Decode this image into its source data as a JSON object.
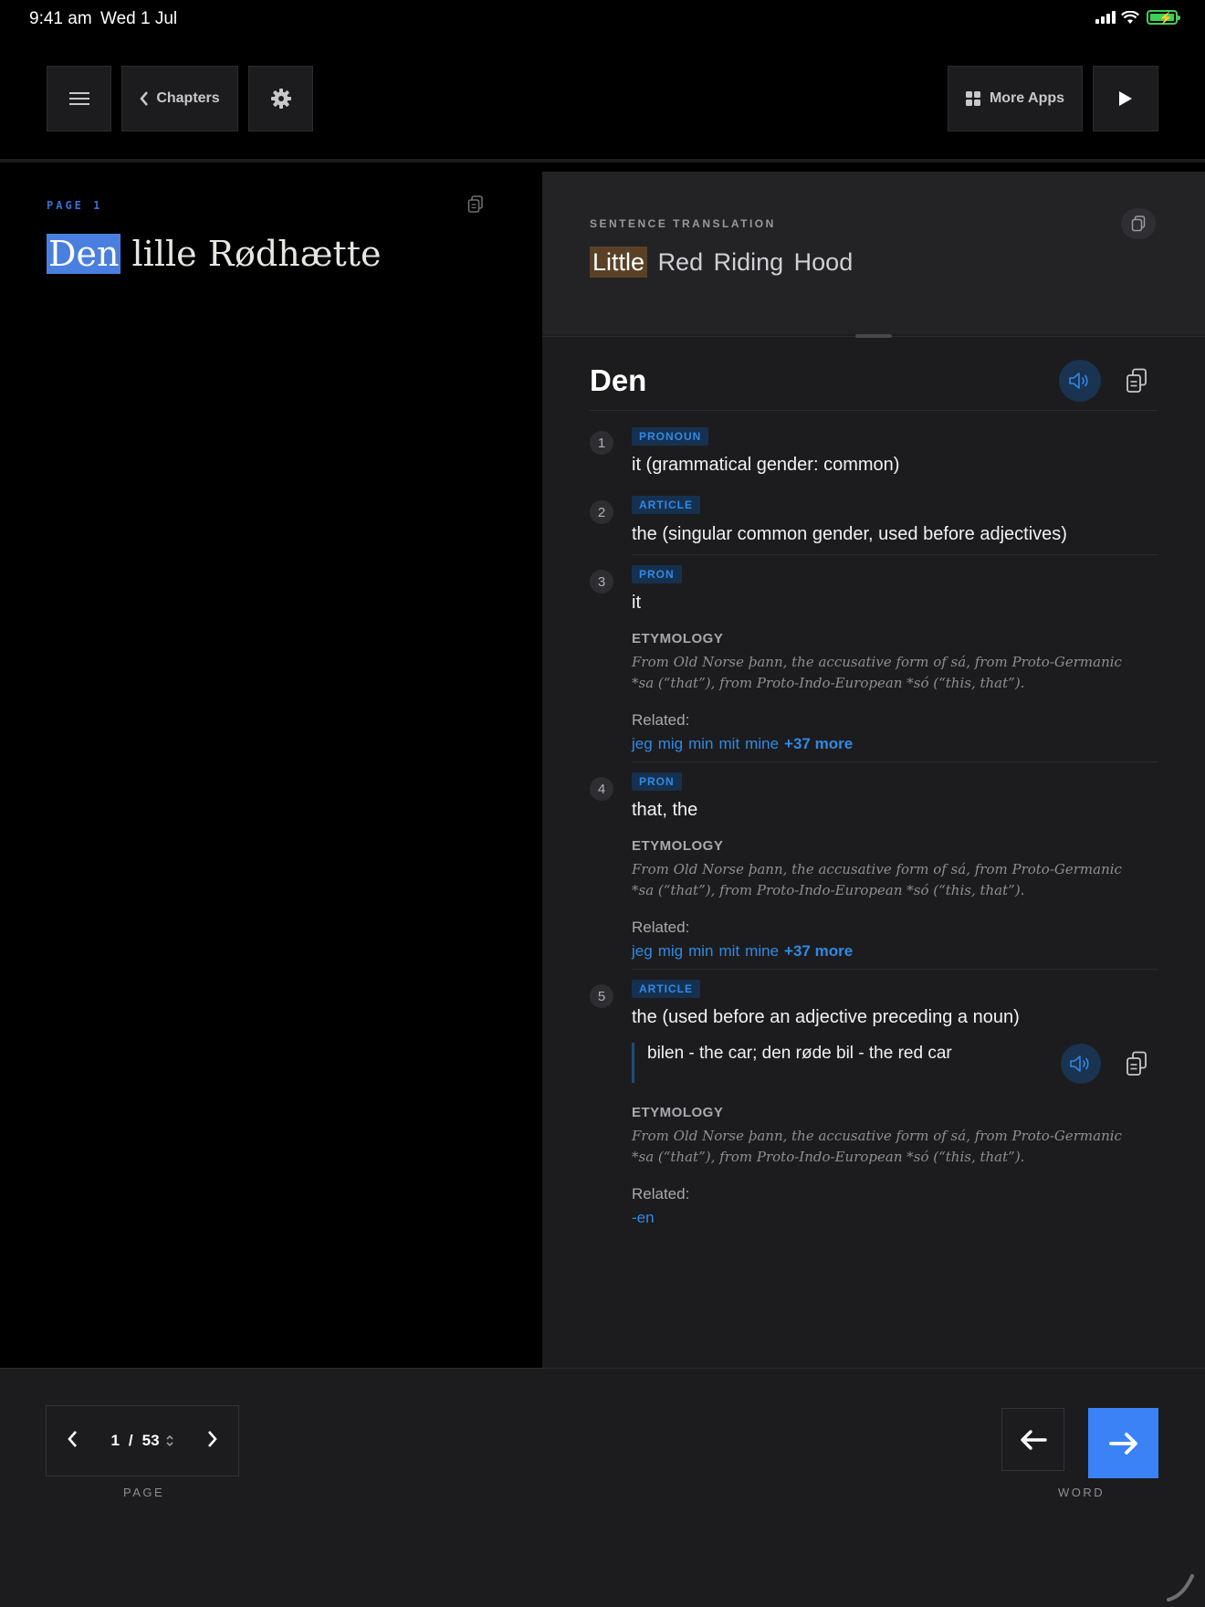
{
  "status": {
    "time": "9:41 am",
    "date": "Wed 1 Jul"
  },
  "toolbar": {
    "chapters_label": "Chapters",
    "more_apps_label": "More Apps"
  },
  "reader": {
    "page_label": "PAGE 1",
    "title_words": [
      "Den",
      "lille",
      "Rødhætte"
    ],
    "highlighted_word": "Den"
  },
  "translation": {
    "label": "SENTENCE TRANSLATION",
    "words": [
      "Little",
      "Red",
      "Riding",
      "Hood"
    ],
    "highlighted_word": "Little"
  },
  "dictionary": {
    "headword": "Den",
    "entries": [
      {
        "number": "1",
        "tag": "PRONOUN",
        "definition": "it (grammatical gender: common)"
      },
      {
        "number": "2",
        "tag": "ARTICLE",
        "definition": "the (singular common gender, used before adjectives)"
      },
      {
        "number": "3",
        "tag": "PRON",
        "definition": "it",
        "etymology_label": "ETYMOLOGY",
        "etymology": "From Old Norse þann, the accusative form of sá, from Proto-Germanic *sa (“that”), from Proto-Indo-European *só (“this, that”).",
        "related_label": "Related:",
        "related": [
          "jeg",
          "mig",
          "min",
          "mit",
          "mine"
        ],
        "related_more": "+37 more"
      },
      {
        "number": "4",
        "tag": "PRON",
        "definition": "that, the",
        "etymology_label": "ETYMOLOGY",
        "etymology": "From Old Norse þann, the accusative form of sá, from Proto-Germanic *sa (“that”), from Proto-Indo-European *só (“this, that”).",
        "related_label": "Related:",
        "related": [
          "jeg",
          "mig",
          "min",
          "mit",
          "mine"
        ],
        "related_more": "+37 more"
      },
      {
        "number": "5",
        "tag": "ARTICLE",
        "definition": "the (used before an adjective preceding a noun)",
        "example": "bilen - the car; den røde bil - the red car",
        "etymology_label": "ETYMOLOGY",
        "etymology": "From Old Norse þann, the accusative form of sá, from Proto-Germanic *sa (“that”), from Proto-Indo-European *só (“this, that”).",
        "related_label": "Related:",
        "related": [
          "-en"
        ]
      }
    ]
  },
  "pager": {
    "current": "1",
    "separator": "/",
    "total": "53",
    "caption": "PAGE"
  },
  "word_nav": {
    "caption": "WORD"
  },
  "colors": {
    "accent": "#3b82f6",
    "tag_text": "#2f8ae6",
    "highlight_source": "#4a7fe0",
    "highlight_translation": "#5a4126"
  },
  "icons": [
    "menu-icon",
    "chevron-left-icon",
    "gear-icon",
    "grid-icon",
    "play-icon",
    "copy-icon",
    "speaker-icon",
    "chevron-right-icon",
    "stepper-icon",
    "arrow-left-icon",
    "arrow-right-icon"
  ]
}
